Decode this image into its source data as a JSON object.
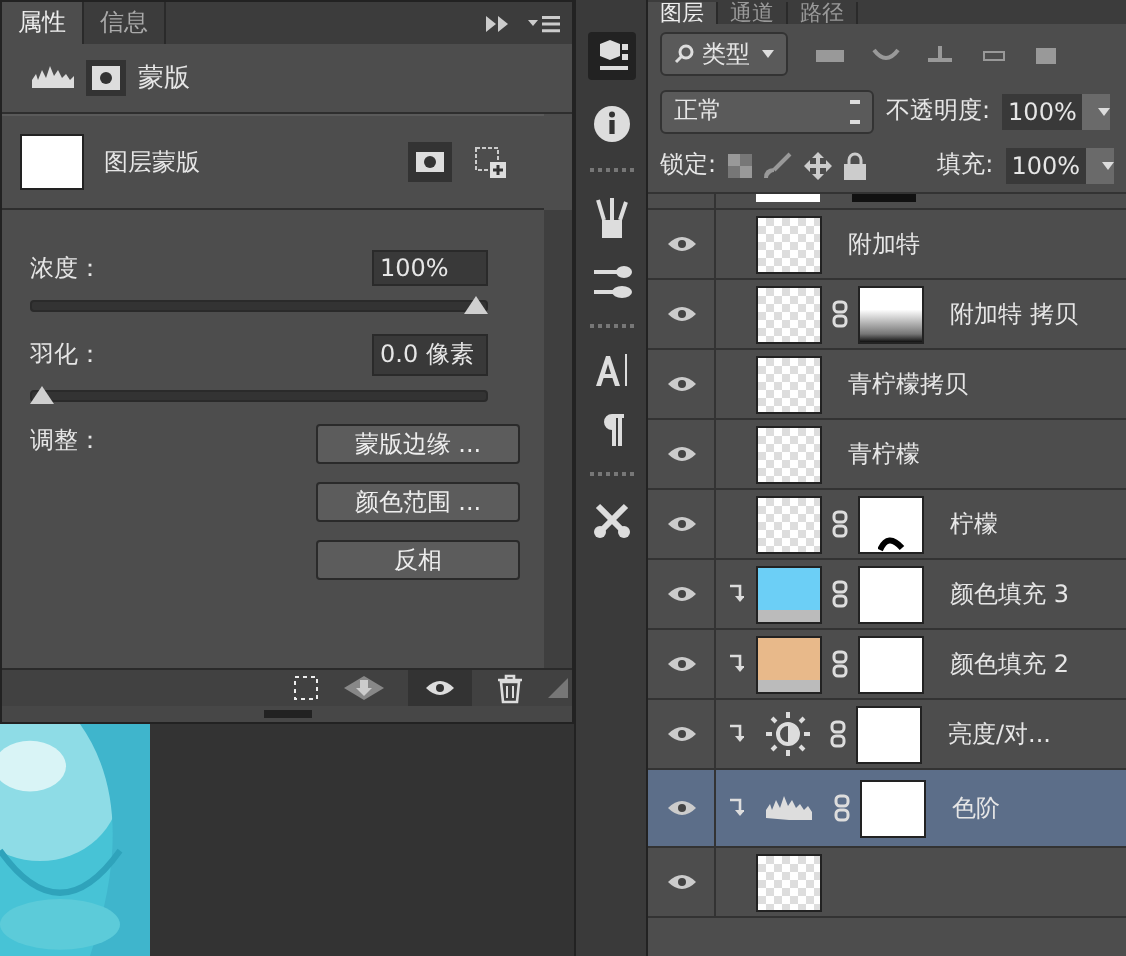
{
  "properties_panel": {
    "tabs": [
      {
        "label": "属性",
        "selected": true
      },
      {
        "label": "信息",
        "selected": false
      }
    ],
    "header": "蒙版",
    "mask_name": "图层蒙版",
    "density": {
      "label": "浓度：",
      "value": "100%",
      "level": 1
    },
    "feather": {
      "label": "羽化：",
      "value": "0.0 像素",
      "level": 0
    },
    "adjust_label": "调整：",
    "buttons": [
      "蒙版边缘 ...",
      "颜色范围 ...",
      "反相"
    ]
  },
  "layers_panel": {
    "tabs": [
      {
        "label": "图层",
        "selected": true
      },
      {
        "label": "通道",
        "selected": false
      },
      {
        "label": "路径",
        "selected": false
      }
    ],
    "filter": "类型",
    "blend_mode": "正常",
    "opacity_label": "不透明度:",
    "opacity": "100%",
    "lock_label": "锁定:",
    "fill_label": "填充:",
    "fill": "100%",
    "layers": [
      {
        "name": "附加特",
        "kind": "pixel",
        "clipped": false,
        "visible": true,
        "selected": false
      },
      {
        "name": "附加特 拷贝",
        "kind": "pixel",
        "mask": {
          "kind": "gradient"
        },
        "clipped": false,
        "visible": true,
        "selected": false
      },
      {
        "name": "青柠檬拷贝",
        "kind": "pixel",
        "clipped": false,
        "visible": true,
        "selected": false
      },
      {
        "name": "青柠檬",
        "kind": "pixel",
        "clipped": false,
        "visible": true,
        "selected": false
      },
      {
        "name": "柠檬",
        "kind": "pixel",
        "mask": {
          "kind": "shape"
        },
        "clipped": false,
        "visible": true,
        "selected": false
      },
      {
        "name": "颜色填充 3",
        "kind": "fill",
        "color": "#6ccff6",
        "mask": {
          "kind": "white"
        },
        "clipped": true,
        "visible": true,
        "selected": false
      },
      {
        "name": "颜色填充 2",
        "kind": "fill",
        "color": "#e8b98a",
        "mask": {
          "kind": "white"
        },
        "clipped": true,
        "visible": true,
        "selected": false
      },
      {
        "name": "亮度/对...",
        "kind": "brightness",
        "mask": {
          "kind": "white"
        },
        "clipped": true,
        "visible": true,
        "selected": false
      },
      {
        "name": "色阶",
        "kind": "levels",
        "mask": {
          "kind": "white"
        },
        "clipped": true,
        "visible": true,
        "selected": true
      },
      {
        "kind": "pixel",
        "clipped": false,
        "visible": true,
        "selected": false
      }
    ]
  }
}
